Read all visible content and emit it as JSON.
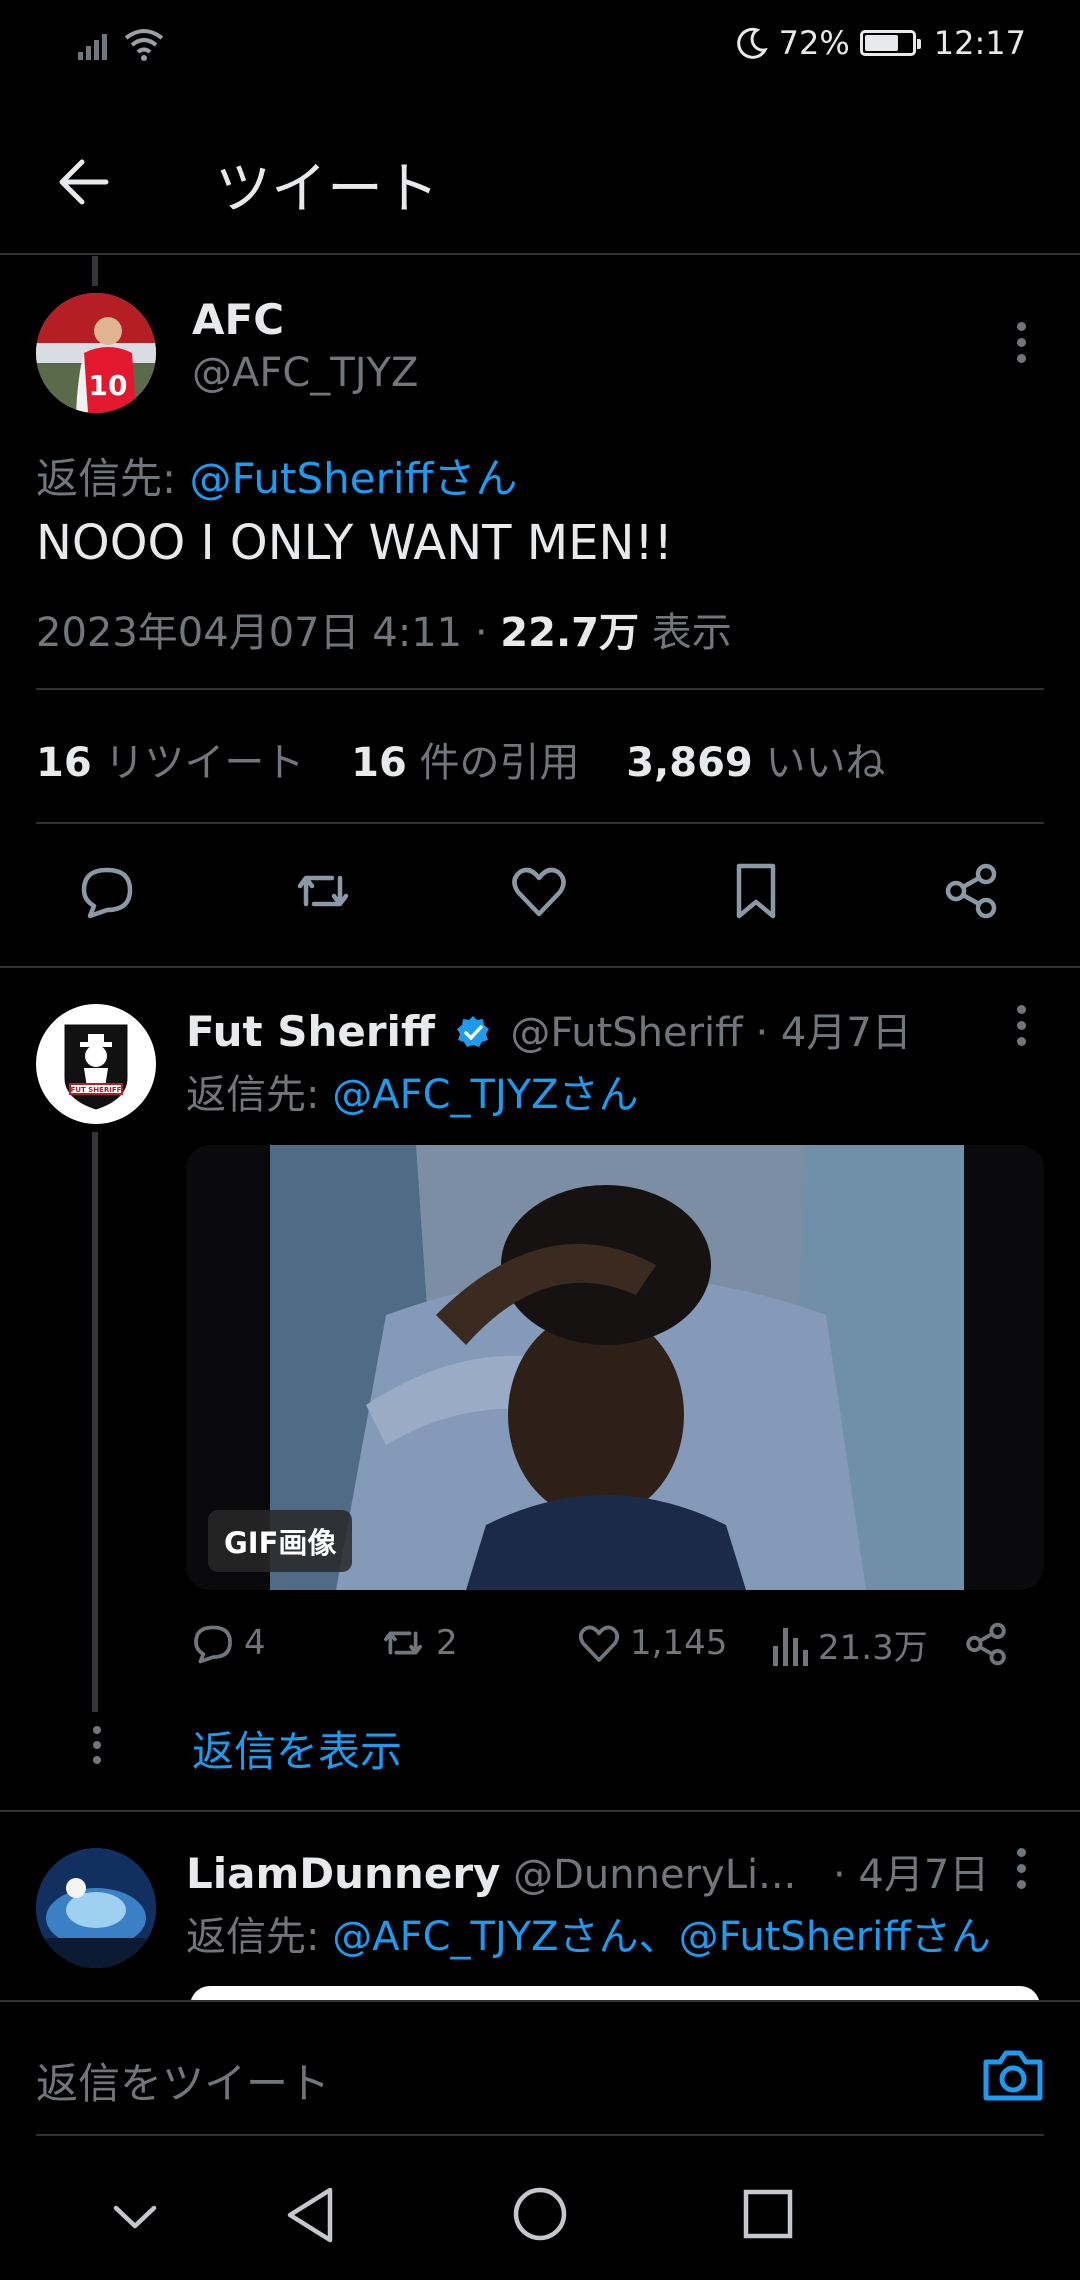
{
  "status_bar": {
    "battery_percent": "72%",
    "time": "12:17",
    "battery_level": 0.72
  },
  "header": {
    "title": "ツイート"
  },
  "main_tweet": {
    "author_name": "AFC",
    "author_handle": "@AFC_TJYZ",
    "reply_prefix": "返信先: ",
    "reply_to": "@FutSheriffさん",
    "text": "NOOO I ONLY WANT MEN!!",
    "timestamp": "2023年04月07日 4:11 · ",
    "views_count": "22.7万",
    "views_label": " 表示",
    "retweets_count": "16",
    "retweets_label": " リツイート",
    "quotes_count": "16",
    "quotes_label": " 件の引用",
    "likes_count": "3,869",
    "likes_label": " いいね"
  },
  "reply1": {
    "author_name": "Fut Sheriff",
    "author_handle": "@FutSheriff",
    "date": " · 4月7日",
    "reply_prefix": "返信先: ",
    "reply_to": "@AFC_TJYZさん",
    "gif_label": "GIF画像",
    "avatar_text": "FUT SHERIFF",
    "replies": "4",
    "retweets": "2",
    "likes": "1,145",
    "views": "21.3万",
    "show_replies": "返信を表示"
  },
  "reply2": {
    "author_name": "LiamDunnery",
    "author_handle": "@DunneryLi...",
    "date": " · 4月7日",
    "reply_prefix": "返信先: ",
    "reply_to": "@AFC_TJYZさん、@FutSheriffさん"
  },
  "compose": {
    "placeholder": "返信をツイート"
  },
  "colors": {
    "accent": "#1d9bf0",
    "background": "#000000",
    "muted": "#71767b",
    "divider": "#2f3336"
  }
}
